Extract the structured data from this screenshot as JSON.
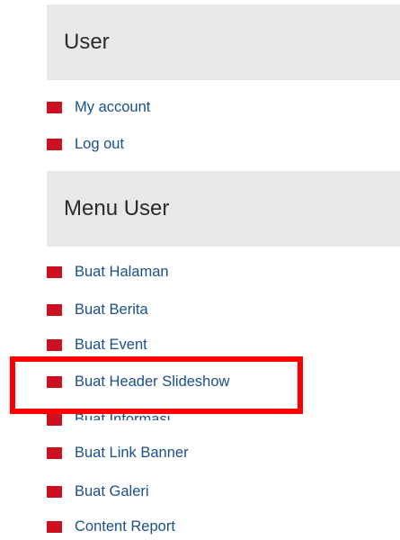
{
  "user_block": {
    "title": "User",
    "items": [
      {
        "label": "My account"
      },
      {
        "label": "Log out"
      }
    ]
  },
  "menu_user_block": {
    "title": "Menu User",
    "items": [
      {
        "label": "Buat Halaman"
      },
      {
        "label": "Buat Berita"
      },
      {
        "label": "Buat Event"
      },
      {
        "label": "Buat Header Slideshow"
      },
      {
        "label": "Buat Informasi"
      },
      {
        "label": "Buat Link Banner"
      },
      {
        "label": "Buat Galeri"
      },
      {
        "label": "Content Report"
      }
    ]
  },
  "colors": {
    "bullet": "#cc1020",
    "link": "#1a4f8a",
    "header_bg": "#e8e8e8",
    "highlight": "#ff0000"
  }
}
